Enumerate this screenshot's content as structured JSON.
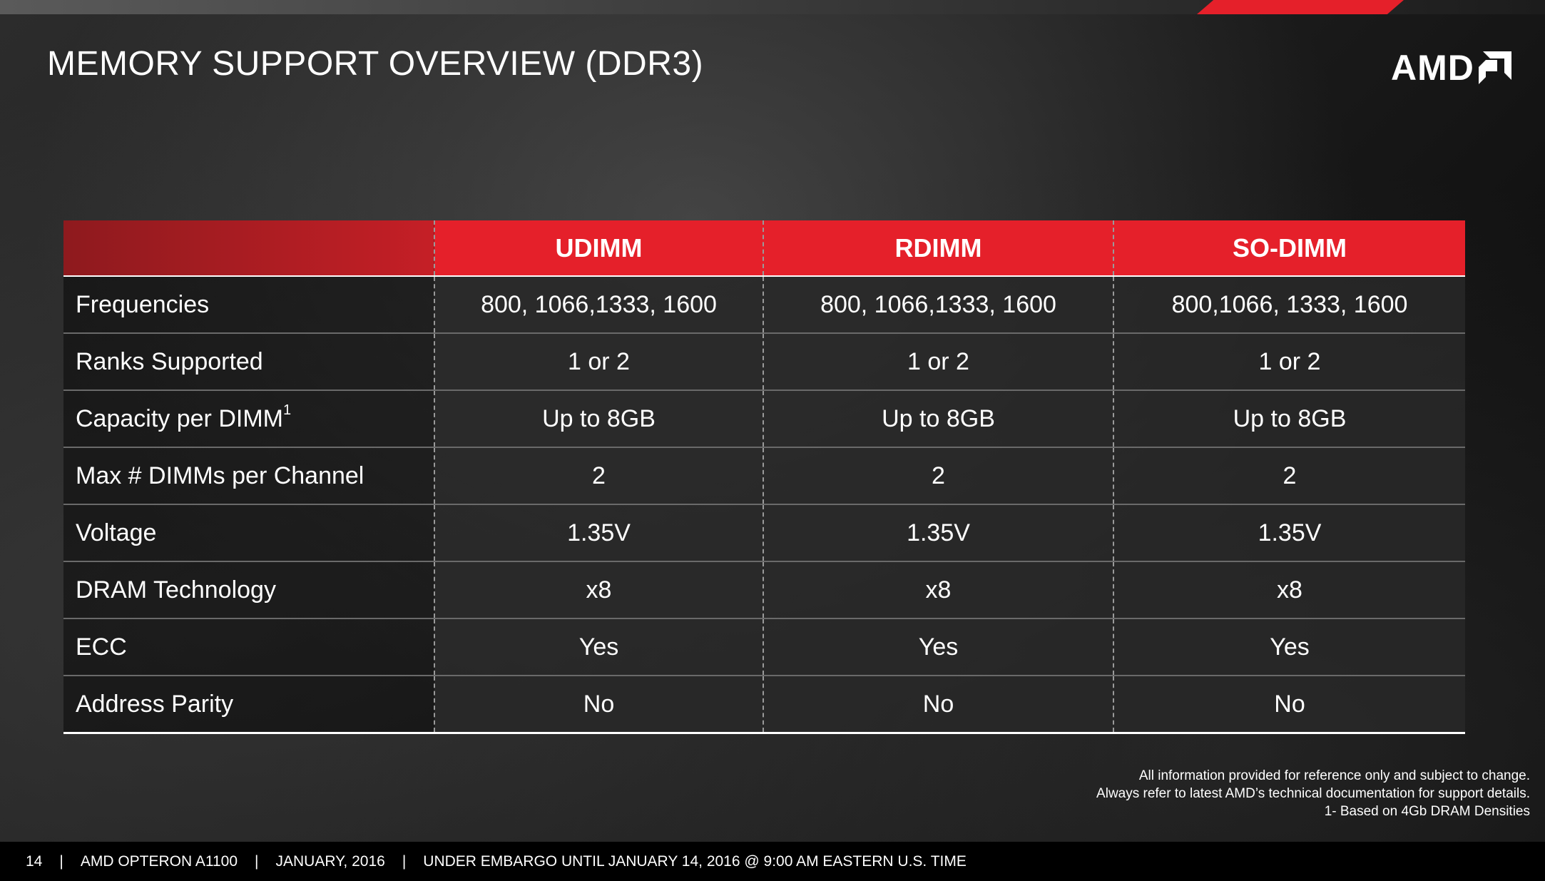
{
  "title": "MEMORY SUPPORT OVERVIEW (DDR3)",
  "logo": {
    "text": "AMD",
    "icon": "amd-arrow-icon"
  },
  "colors": {
    "accent": "#e5202a",
    "background": "#1e1e1e"
  },
  "table": {
    "columns": [
      "UDIMM",
      "RDIMM",
      "SO-DIMM"
    ],
    "rows": [
      {
        "label": "Frequencies",
        "values": [
          "800, 1066,1333, 1600",
          "800, 1066,1333, 1600",
          "800,1066, 1333, 1600"
        ]
      },
      {
        "label": "Ranks Supported",
        "values": [
          "1 or 2",
          "1 or 2",
          "1 or 2"
        ]
      },
      {
        "label": "Capacity per DIMM",
        "sup": "1",
        "values": [
          "Up to 8GB",
          "Up to 8GB",
          "Up to 8GB"
        ]
      },
      {
        "label": "Max # DIMMs per Channel",
        "values": [
          "2",
          "2",
          "2"
        ]
      },
      {
        "label": "Voltage",
        "values": [
          "1.35V",
          "1.35V",
          "1.35V"
        ]
      },
      {
        "label": "DRAM Technology",
        "values": [
          "x8",
          "x8",
          "x8"
        ]
      },
      {
        "label": "ECC",
        "values": [
          "Yes",
          "Yes",
          "Yes"
        ]
      },
      {
        "label": "Address Parity",
        "values": [
          "No",
          "No",
          "No"
        ]
      }
    ]
  },
  "notes": [
    "All information provided for reference only and subject to change.",
    "Always refer to latest AMD’s technical documentation for support details.",
    "1-  Based on 4Gb DRAM Densities"
  ],
  "footer": {
    "page": "14",
    "product": "AMD OPTERON A1100",
    "date": "JANUARY, 2016",
    "embargo": "UNDER EMBARGO UNTIL JANUARY 14, 2016 @ 9:00 AM EASTERN U.S. TIME",
    "separator": "|"
  }
}
